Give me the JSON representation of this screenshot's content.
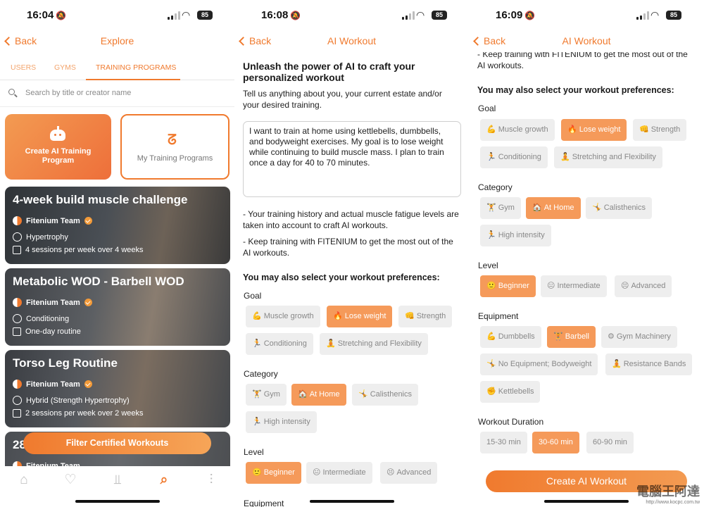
{
  "screen1": {
    "status": {
      "time": "16:04",
      "battery": "85"
    },
    "nav": {
      "back": "Back",
      "title": "Explore"
    },
    "tabs": [
      "USERS",
      "GYMS",
      "TRAINING PROGRAMS"
    ],
    "search_placeholder": "Search by title or creator name",
    "tiles": {
      "ai": "Create AI Training Program",
      "mine": "My Training Programs"
    },
    "cards": [
      {
        "title": "4-week build muscle challenge",
        "team": "Fitenium Team",
        "focus": "Hypertrophy",
        "schedule": "4 sessions per week over 4 weeks"
      },
      {
        "title": "Metabolic WOD - Barbell WOD",
        "team": "Fitenium Team",
        "focus": "Conditioning",
        "schedule": "One-day routine"
      },
      {
        "title": "Torso Leg Routine",
        "team": "Fitenium Team",
        "focus": "Hybrid (Strength Hypertrophy)",
        "schedule": "2 sessions per week over 2 weeks"
      },
      {
        "title": "28",
        "team": "Fitenium Team"
      }
    ],
    "filter_button": "Filter Certified Workouts",
    "tabbar_icons": [
      "home-icon",
      "heart-rate-icon",
      "dumbbell-icon",
      "search-icon",
      "podium-icon"
    ]
  },
  "screen2": {
    "status": {
      "time": "16:08",
      "battery": "85"
    },
    "nav": {
      "back": "Back",
      "title": "AI Workout"
    },
    "heading": "Unleash the power of AI to craft your personalized workout",
    "intro": "Tell us anything about you, your current estate and/or your desired training.",
    "prompt_text": "I want to train at home using kettlebells, dumbbells, and bodyweight exercises. My goal is to lose weight while continuing to build muscle mass. I plan to train once a day for 40 to 70 minutes.",
    "note1": "- Your training history and actual muscle fatigue levels are taken into account to craft AI workouts.",
    "note2": "- Keep training with FITENIUM to get the most out of the AI workouts.",
    "prefs_heading": "You may also select your workout preferences:",
    "goal_label": "Goal",
    "goal": [
      "Muscle growth",
      "Lose weight",
      "Strength",
      "Conditioning",
      "Stretching and Flexibility"
    ],
    "category_label": "Category",
    "category": [
      "Gym",
      "At Home",
      "Calisthenics",
      "High intensity"
    ],
    "level_label": "Level",
    "level": [
      "Beginner",
      "Intermediate",
      "Advanced"
    ],
    "equipment_label": "Equipment"
  },
  "screen3": {
    "status": {
      "time": "16:09",
      "battery": "85"
    },
    "nav": {
      "back": "Back",
      "title": "AI Workout"
    },
    "note2": "- Keep training with FITENIUM to get the most out of the AI workouts.",
    "prefs_heading": "You may also select your workout preferences:",
    "goal_label": "Goal",
    "goal": [
      "Muscle growth",
      "Lose weight",
      "Strength",
      "Conditioning",
      "Stretching and Flexibility"
    ],
    "category_label": "Category",
    "category": [
      "Gym",
      "At Home",
      "Calisthenics",
      "High intensity"
    ],
    "level_label": "Level",
    "level": [
      "Beginner",
      "Intermediate",
      "Advanced"
    ],
    "equipment_label": "Equipment",
    "equipment": [
      "Dumbbells",
      "Barbell",
      "Gym Machinery",
      "No Equipment; Bodyweight",
      "Resistance Bands",
      "Kettlebells"
    ],
    "duration_label": "Workout Duration",
    "duration": [
      "15-30 min",
      "30-60 min",
      "60-90 min"
    ],
    "create_button": "Create AI Workout",
    "watermark": "電腦王阿達",
    "watermark_url": "http://www.kocpc.com.tw"
  },
  "colors": {
    "accent": "#f07a2e",
    "chip": "#eeeeee",
    "chip_selected": "#f59a5a"
  }
}
